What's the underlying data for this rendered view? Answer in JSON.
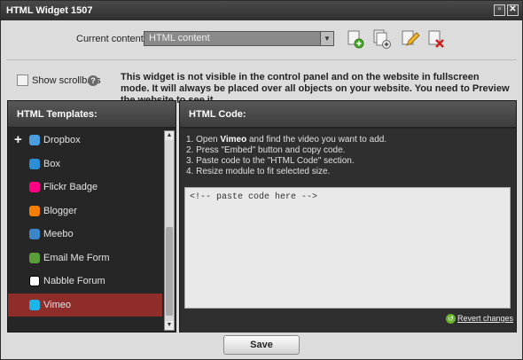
{
  "window": {
    "title": "HTML Widget 1507",
    "minimize_glyph": "▫",
    "close_glyph": "✕"
  },
  "content_selector": {
    "label": "Current content:",
    "selected": "HTML content",
    "arrow_glyph": "▼"
  },
  "toolbar": {
    "icons": [
      "add-page-icon",
      "duplicate-page-icon",
      "edit-page-icon",
      "delete-page-icon"
    ]
  },
  "scrollbars": {
    "label": "Show scrollbars",
    "checked": false,
    "help_glyph": "?"
  },
  "notice": "This widget is not visible in the control panel and on the website in fullscreen mode. It will always be placed over all objects on your website. You need to Preview the website to see it.",
  "templates": {
    "heading": "HTML Templates:",
    "expander_glyph": "+",
    "items": [
      {
        "label": "Dropbox",
        "icon": "dropbox-icon",
        "color": "#4a9fe0"
      },
      {
        "label": "Box",
        "icon": "box-icon",
        "color": "#2b8fd8"
      },
      {
        "label": "Flickr Badge",
        "icon": "flickr-icon",
        "color": "#ff0084"
      },
      {
        "label": "Blogger",
        "icon": "blogger-icon",
        "color": "#f57d00"
      },
      {
        "label": "Meebo",
        "icon": "meebo-icon",
        "color": "#3a86c6"
      },
      {
        "label": "Email Me Form",
        "icon": "email-form-icon",
        "color": "#5a9e3a"
      },
      {
        "label": "Nabble Forum",
        "icon": "nabble-icon",
        "color": "#ffffff"
      },
      {
        "label": "Vimeo",
        "icon": "vimeo-icon",
        "color": "#1ab7ea"
      }
    ],
    "active": "Vimeo",
    "scroll_up_glyph": "▲",
    "scroll_down_glyph": "▼"
  },
  "code_panel": {
    "heading": "HTML Code:",
    "steps": {
      "s1_pre": "1. Open ",
      "s1_bold": "Vimeo",
      "s1_post": " and find the video you want to add.",
      "s2": "2. Press \"Embed\" button and copy code.",
      "s3": "3. Paste code to the \"HTML Code\" section.",
      "s4": "4. Resize module to fit selected size."
    },
    "code_text": "<!-- paste code here -->",
    "revert_label": "Revert changes",
    "revert_glyph": "↺"
  },
  "save_label": "Save",
  "colors": {
    "active_item": "#8e2d2a",
    "panel_bg": "#262626",
    "dialog_bg": "#dcdcdc"
  }
}
